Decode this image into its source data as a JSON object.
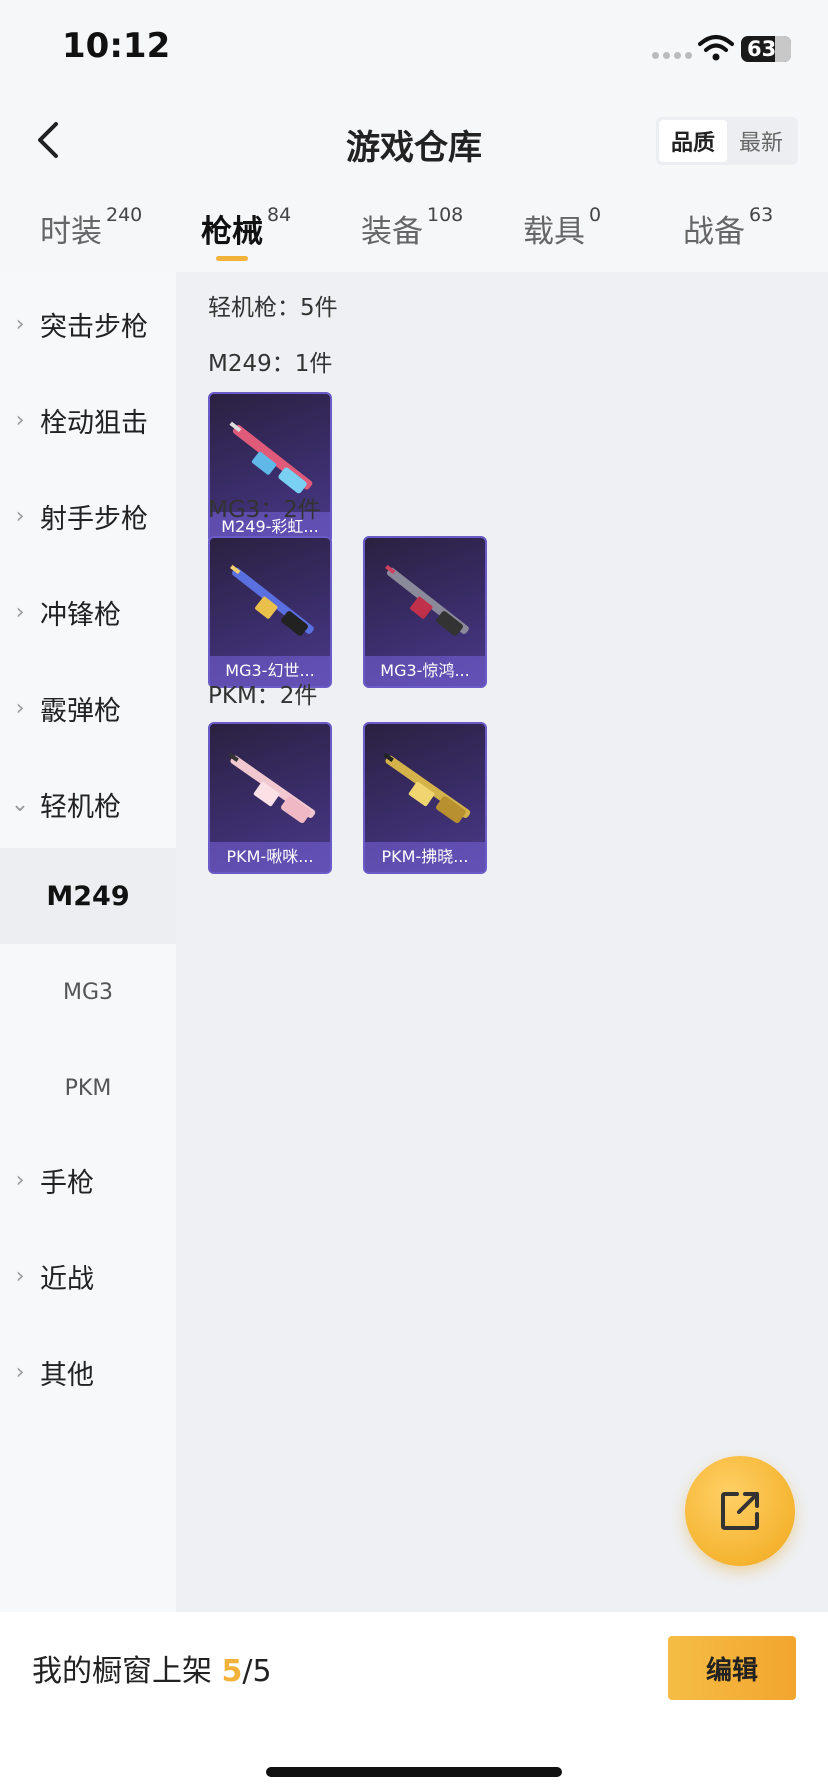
{
  "status_bar": {
    "time": "10:12",
    "battery": "63"
  },
  "header": {
    "title": "游戏仓库",
    "sort_options": [
      "品质",
      "最新"
    ],
    "active_sort": "品质"
  },
  "tabs": [
    {
      "label": "时装",
      "count": "240"
    },
    {
      "label": "枪械",
      "count": "84"
    },
    {
      "label": "装备",
      "count": "108"
    },
    {
      "label": "载具",
      "count": "0"
    },
    {
      "label": "战备",
      "count": "63"
    }
  ],
  "active_tab": "枪械",
  "sidebar": {
    "items": [
      "突击步枪",
      "栓动狙击",
      "射手步枪",
      "冲锋枪",
      "霰弹枪",
      "轻机枪"
    ],
    "expanded": "轻机枪",
    "sub_items": [
      "M249",
      "MG3",
      "PKM"
    ],
    "active_sub": "M249",
    "more_items": [
      "手枪",
      "近战",
      "其他"
    ]
  },
  "content": {
    "category_label": "轻机枪：5件",
    "groups": [
      {
        "label": "M249：1件",
        "items": [
          "M249-彩虹..."
        ]
      },
      {
        "label": "MG3：2件",
        "items": [
          "MG3-幻世...",
          "MG3-惊鸿..."
        ]
      },
      {
        "label": "PKM：2件",
        "items": [
          "PKM-啾咪...",
          "PKM-拂晓..."
        ]
      }
    ]
  },
  "bottom_bar": {
    "showcase_label": "我的橱窗上架",
    "current": "5",
    "total": "/5",
    "edit_label": "编辑"
  },
  "colors": {
    "accent": "#f2b23a",
    "card_purple": "#3a2d6a"
  }
}
